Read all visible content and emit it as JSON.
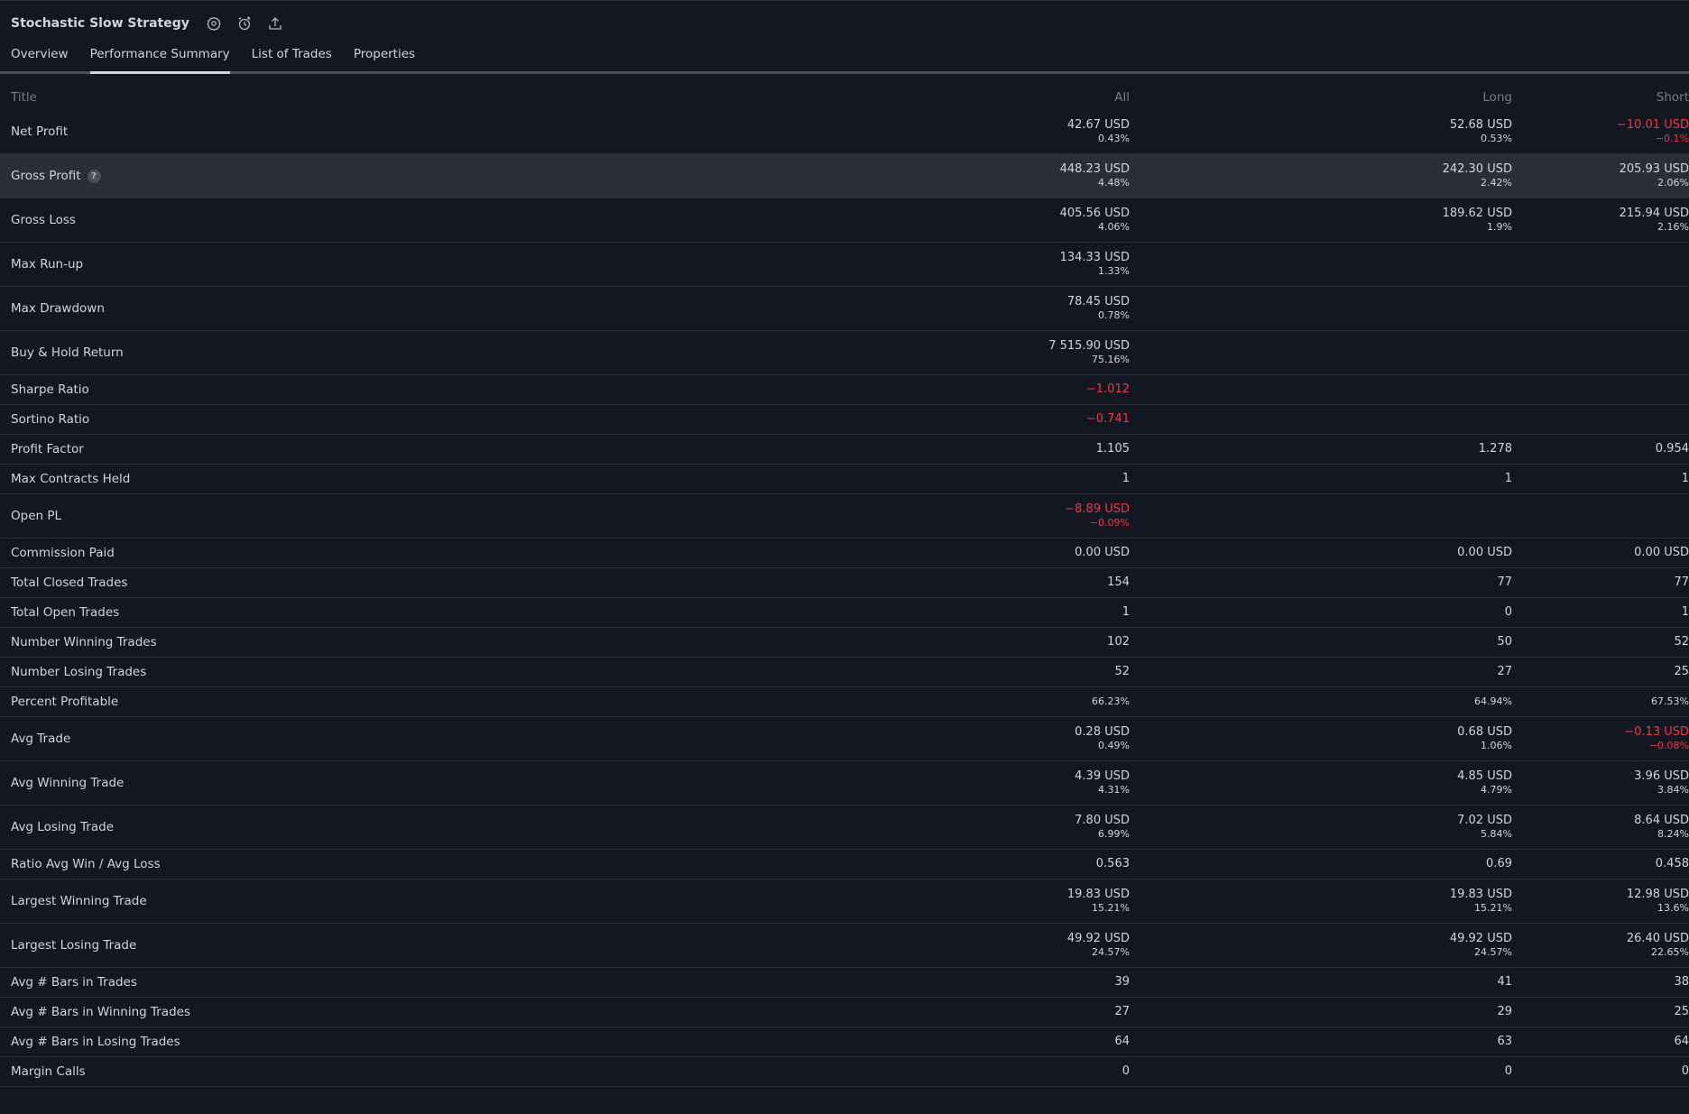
{
  "header": {
    "title": "Stochastic Slow Strategy",
    "icons": [
      "settings-icon",
      "alert-icon",
      "export-icon"
    ]
  },
  "tabs": [
    {
      "label": "Overview",
      "active": false
    },
    {
      "label": "Performance Summary",
      "active": true
    },
    {
      "label": "List of Trades",
      "active": false
    },
    {
      "label": "Properties",
      "active": false
    }
  ],
  "columns": {
    "title": "Title",
    "all": "All",
    "long": "Long",
    "short": "Short"
  },
  "colors": {
    "background": "#131722",
    "text": "#d1d4dc",
    "muted": "#787b86",
    "negative": "#f23645",
    "highlight_row": "#2a2e39"
  },
  "rows": [
    {
      "title": "Net Profit",
      "all": {
        "main": "42.67 USD",
        "sub": "0.43%"
      },
      "long": {
        "main": "52.68 USD",
        "sub": "0.53%"
      },
      "short": {
        "main": "−10.01 USD",
        "sub": "−0.1%",
        "neg": true
      }
    },
    {
      "title": "Gross Profit",
      "help": true,
      "highlight": true,
      "all": {
        "main": "448.23 USD",
        "sub": "4.48%"
      },
      "long": {
        "main": "242.30 USD",
        "sub": "2.42%"
      },
      "short": {
        "main": "205.93 USD",
        "sub": "2.06%"
      }
    },
    {
      "title": "Gross Loss",
      "all": {
        "main": "405.56 USD",
        "sub": "4.06%"
      },
      "long": {
        "main": "189.62 USD",
        "sub": "1.9%"
      },
      "short": {
        "main": "215.94 USD",
        "sub": "2.16%"
      }
    },
    {
      "title": "Max Run-up",
      "all": {
        "main": "134.33 USD",
        "sub": "1.33%"
      },
      "long": null,
      "short": null
    },
    {
      "title": "Max Drawdown",
      "all": {
        "main": "78.45 USD",
        "sub": "0.78%"
      },
      "long": null,
      "short": null
    },
    {
      "title": "Buy & Hold Return",
      "all": {
        "main": "7 515.90 USD",
        "sub": "75.16%"
      },
      "long": null,
      "short": null
    },
    {
      "title": "Sharpe Ratio",
      "all": {
        "main": "−1.012",
        "neg": true
      },
      "long": null,
      "short": null
    },
    {
      "title": "Sortino Ratio",
      "all": {
        "main": "−0.741",
        "neg": true
      },
      "long": null,
      "short": null
    },
    {
      "title": "Profit Factor",
      "all": {
        "main": "1.105"
      },
      "long": {
        "main": "1.278"
      },
      "short": {
        "main": "0.954"
      }
    },
    {
      "title": "Max Contracts Held",
      "all": {
        "main": "1"
      },
      "long": {
        "main": "1"
      },
      "short": {
        "main": "1"
      }
    },
    {
      "title": "Open PL",
      "all": {
        "main": "−8.89 USD",
        "sub": "−0.09%",
        "neg": true
      },
      "long": null,
      "short": null
    },
    {
      "title": "Commission Paid",
      "all": {
        "main": "0.00 USD"
      },
      "long": {
        "main": "0.00 USD"
      },
      "short": {
        "main": "0.00 USD"
      }
    },
    {
      "title": "Total Closed Trades",
      "all": {
        "main": "154"
      },
      "long": {
        "main": "77"
      },
      "short": {
        "main": "77"
      }
    },
    {
      "title": "Total Open Trades",
      "all": {
        "main": "1"
      },
      "long": {
        "main": "0"
      },
      "short": {
        "main": "1"
      }
    },
    {
      "title": "Number Winning Trades",
      "all": {
        "main": "102"
      },
      "long": {
        "main": "50"
      },
      "short": {
        "main": "52"
      }
    },
    {
      "title": "Number Losing Trades",
      "all": {
        "main": "52"
      },
      "long": {
        "main": "27"
      },
      "short": {
        "main": "25"
      }
    },
    {
      "title": "Percent Profitable",
      "all": {
        "main": "66.23%",
        "small": true
      },
      "long": {
        "main": "64.94%",
        "small": true
      },
      "short": {
        "main": "67.53%",
        "small": true
      }
    },
    {
      "title": "Avg Trade",
      "all": {
        "main": "0.28 USD",
        "sub": "0.49%"
      },
      "long": {
        "main": "0.68 USD",
        "sub": "1.06%"
      },
      "short": {
        "main": "−0.13 USD",
        "sub": "−0.08%",
        "neg": true
      }
    },
    {
      "title": "Avg Winning Trade",
      "all": {
        "main": "4.39 USD",
        "sub": "4.31%"
      },
      "long": {
        "main": "4.85 USD",
        "sub": "4.79%"
      },
      "short": {
        "main": "3.96 USD",
        "sub": "3.84%"
      }
    },
    {
      "title": "Avg Losing Trade",
      "all": {
        "main": "7.80 USD",
        "sub": "6.99%"
      },
      "long": {
        "main": "7.02 USD",
        "sub": "5.84%"
      },
      "short": {
        "main": "8.64 USD",
        "sub": "8.24%"
      }
    },
    {
      "title": "Ratio Avg Win / Avg Loss",
      "all": {
        "main": "0.563"
      },
      "long": {
        "main": "0.69"
      },
      "short": {
        "main": "0.458"
      }
    },
    {
      "title": "Largest Winning Trade",
      "all": {
        "main": "19.83 USD",
        "sub": "15.21%"
      },
      "long": {
        "main": "19.83 USD",
        "sub": "15.21%"
      },
      "short": {
        "main": "12.98 USD",
        "sub": "13.6%"
      }
    },
    {
      "title": "Largest Losing Trade",
      "all": {
        "main": "49.92 USD",
        "sub": "24.57%"
      },
      "long": {
        "main": "49.92 USD",
        "sub": "24.57%"
      },
      "short": {
        "main": "26.40 USD",
        "sub": "22.65%"
      }
    },
    {
      "title": "Avg # Bars in Trades",
      "all": {
        "main": "39"
      },
      "long": {
        "main": "41"
      },
      "short": {
        "main": "38"
      }
    },
    {
      "title": "Avg # Bars in Winning Trades",
      "all": {
        "main": "27"
      },
      "long": {
        "main": "29"
      },
      "short": {
        "main": "25"
      }
    },
    {
      "title": "Avg # Bars in Losing Trades",
      "all": {
        "main": "64"
      },
      "long": {
        "main": "63"
      },
      "short": {
        "main": "64"
      }
    },
    {
      "title": "Margin Calls",
      "all": {
        "main": "0"
      },
      "long": {
        "main": "0"
      },
      "short": {
        "main": "0"
      }
    }
  ]
}
